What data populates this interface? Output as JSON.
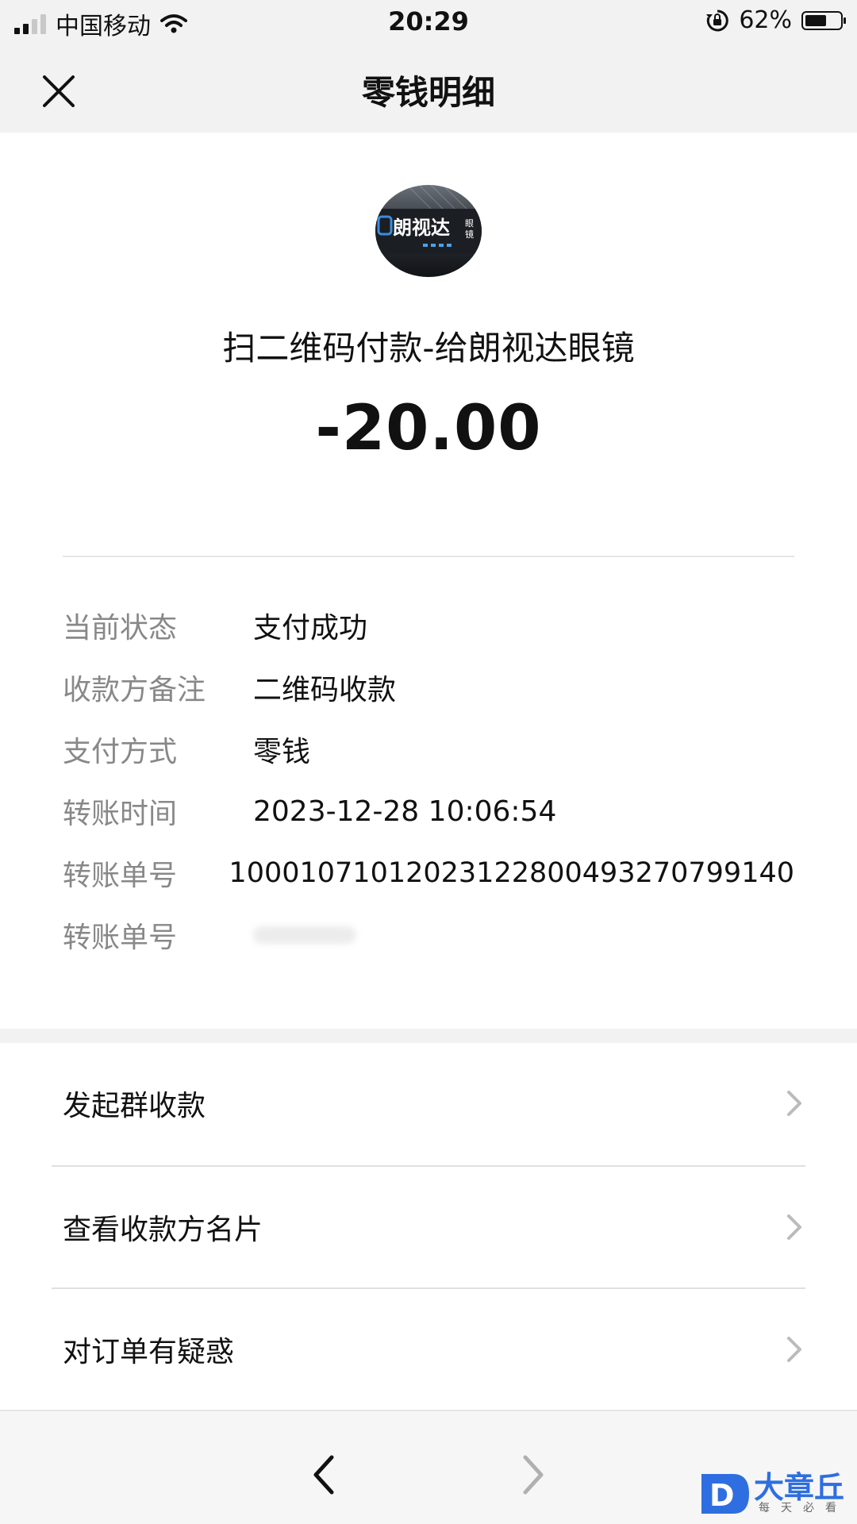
{
  "status_bar": {
    "carrier": "中国移动",
    "time": "20:29",
    "battery_percent": "62%",
    "battery_level": 0.62
  },
  "nav": {
    "title": "零钱明细",
    "close_icon": "close-icon"
  },
  "merchant": {
    "avatar_text": "朗视达",
    "avatar_side_text": "眼镜",
    "title": "扫二维码付款-给朗视达眼镜",
    "amount": "-20.00"
  },
  "details": [
    {
      "label": "当前状态",
      "value": "支付成功"
    },
    {
      "label": "收款方备注",
      "value": "二维码收款"
    },
    {
      "label": "支付方式",
      "value": "零钱"
    },
    {
      "label": "转账时间",
      "value": "2023-12-28 10:06:54"
    },
    {
      "label": "转账单号",
      "value": "10001071012023122800493270799140"
    },
    {
      "label": "转账单号",
      "value": ""
    }
  ],
  "actions": [
    {
      "label": "发起群收款"
    },
    {
      "label": "查看收款方名片"
    },
    {
      "label": "对订单有疑惑"
    }
  ],
  "toolbar": {
    "back_icon": "chevron-left-icon",
    "forward_icon": "chevron-right-icon"
  },
  "watermark": {
    "text": "大章丘",
    "sub": "每天必看",
    "logo_letter": "D"
  },
  "colors": {
    "nav_bg": "#f2f2f2",
    "label_gray": "#888888",
    "watermark_blue": "#2f6ee0"
  }
}
